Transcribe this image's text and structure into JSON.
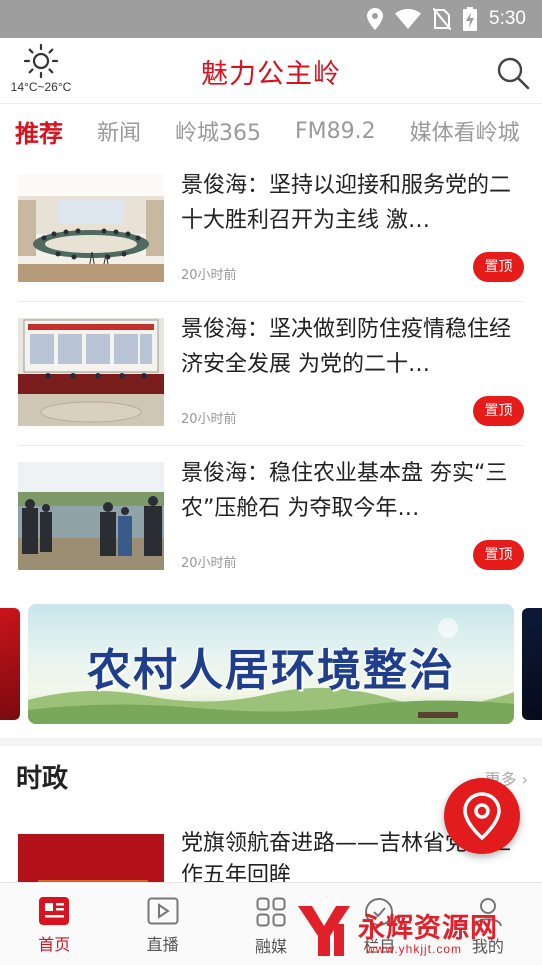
{
  "status_bar": {
    "time": "5:30",
    "icons": [
      "location-icon",
      "wifi-icon",
      "no-sim-icon",
      "battery-charging-icon"
    ]
  },
  "header": {
    "title": "魅力公主岭",
    "weather": {
      "temperature": "14°C~26°C",
      "icon": "sun-icon"
    },
    "search_icon": "search-icon"
  },
  "tabs": [
    {
      "label": "推荐",
      "active": true
    },
    {
      "label": "新闻",
      "active": false
    },
    {
      "label": "岭城365",
      "active": false
    },
    {
      "label": "FM89.2",
      "active": false
    },
    {
      "label": "媒体看岭城",
      "active": false
    }
  ],
  "news": [
    {
      "title": "景俊海：坚持以迎接和服务党的二十大胜利召开为主线 激…",
      "time": "20小时前",
      "badge": "置顶"
    },
    {
      "title": "景俊海：坚决做到防住疫情稳住经济安全发展 为党的二十…",
      "time": "20小时前",
      "badge": "置顶"
    },
    {
      "title": "景俊海：稳住农业基本盘 夯实“三农”压舱石 为夺取今年…",
      "time": "20小时前",
      "badge": "置顶"
    }
  ],
  "banner": {
    "text": "农村人居环境整治"
  },
  "section": {
    "title": "时政",
    "more": "更多",
    "item_title": "党旗领航奋进路——吉林省党建工作五年回眸"
  },
  "bottom_nav": [
    {
      "label": "首页",
      "icon": "home-news-icon",
      "active": true
    },
    {
      "label": "直播",
      "icon": "live-video-icon",
      "active": false
    },
    {
      "label": "融媒",
      "icon": "media-grid-icon",
      "active": false
    },
    {
      "label": "栏目",
      "icon": "column-icon",
      "active": false
    },
    {
      "label": "我的",
      "icon": "user-icon",
      "active": false
    }
  ],
  "watermark": {
    "text": "永辉资源网",
    "url": "www.yhkjjt.com"
  },
  "colors": {
    "brand_red": "#d8121f",
    "badge_red": "#e81b1b",
    "status_bar": "#9e9e9e"
  }
}
